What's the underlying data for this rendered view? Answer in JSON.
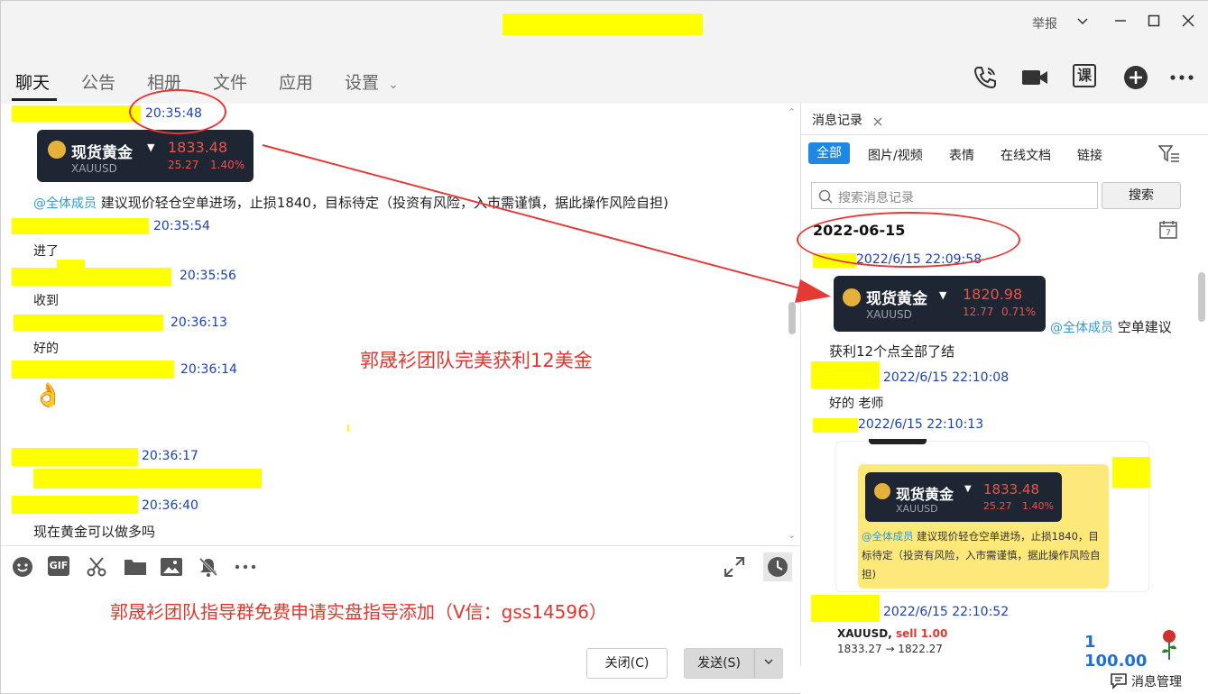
{
  "titlebar": {
    "report_label": "举报",
    "chevron_icon": "chevron-down-icon",
    "minimize_icon": "minimize-icon",
    "maximize_icon": "maximize-icon",
    "close_icon": "close-icon"
  },
  "nav": {
    "tabs": [
      {
        "label": "聊天",
        "active": true
      },
      {
        "label": "公告",
        "active": false
      },
      {
        "label": "相册",
        "active": false
      },
      {
        "label": "文件",
        "active": false
      },
      {
        "label": "应用",
        "active": false
      },
      {
        "label": "设置",
        "active": false
      }
    ],
    "settings_chevron": "⌄",
    "icons": [
      "phone-icon",
      "video-icon",
      "course-icon",
      "add-icon",
      "more-icon"
    ],
    "course_label": "课"
  },
  "chat": {
    "gold_card": {
      "name": "现货黄金",
      "symbol": "XAUUSD",
      "price": "1833.48",
      "change": "25.27",
      "percent": "1.40%"
    },
    "messages": [
      {
        "time": "20:35:48"
      },
      {
        "mention": "@全体成员",
        "text": "建议现价轻仓空单进场，止损1840，目标待定（投资有风险，入市需谨慎，据此操作风险自担)"
      },
      {
        "time": "20:35:54",
        "text": "进了"
      },
      {
        "time": "20:35:56",
        "text": "收到"
      },
      {
        "time": "20:36:13",
        "text": "好的"
      },
      {
        "time": "20:36:14",
        "emoji": "👌"
      },
      {
        "time": "20:36:17"
      },
      {
        "time": "20:36:40",
        "text": "现在黄金可以做多吗"
      }
    ],
    "overlay_text": "郭晟衫团队完美获利12美金"
  },
  "composer": {
    "tools": [
      "emoji-icon",
      "gif-icon",
      "scissors-icon",
      "folder-icon",
      "image-icon",
      "mute-icon",
      "more-icon"
    ],
    "gif_label": "GIF",
    "promo_text": "郭晟衫团队指导群免费申请实盘指导添加（V信：gss14596）",
    "close_label": "关闭(C)",
    "send_label": "发送(S)"
  },
  "history": {
    "tab_label": "消息记录",
    "filters": [
      "全部",
      "图片/视频",
      "表情",
      "在线文档",
      "链接"
    ],
    "search_placeholder": "搜索消息记录",
    "search_button": "搜索",
    "date": "2022-06-15",
    "entries": [
      {
        "time": "2022/6/15 22:09:58"
      },
      {
        "mention": "@全体成员",
        "text": "空单建议"
      },
      {
        "text": "获利12个点全部了结"
      },
      {
        "time": "2022/6/15 22:10:08",
        "text": "好的  老师"
      },
      {
        "time": "2022/6/15 22:10:13"
      },
      {
        "time": "2022/6/15 22:10:52"
      }
    ],
    "gold_card": {
      "name": "现货黄金",
      "symbol": "XAUUSD",
      "price": "1820.98",
      "change": "12.77",
      "percent": "0.71%"
    },
    "quoted_card": {
      "name": "现货黄金",
      "symbol": "XAUUSD",
      "price": "1833.48",
      "change": "25.27",
      "percent": "1.40%",
      "mention": "@全体成员",
      "text": "建议现价轻仓空单进场，止损1840，目标待定（投资有风险，入市需谨慎，据此操作风险自担)"
    },
    "trade": {
      "symbol": "XAUUSD,",
      "side": "sell 1.00",
      "prices": "1833.27 → 1822.27",
      "profit": "1 100.00"
    },
    "manage_label": "消息管理"
  }
}
